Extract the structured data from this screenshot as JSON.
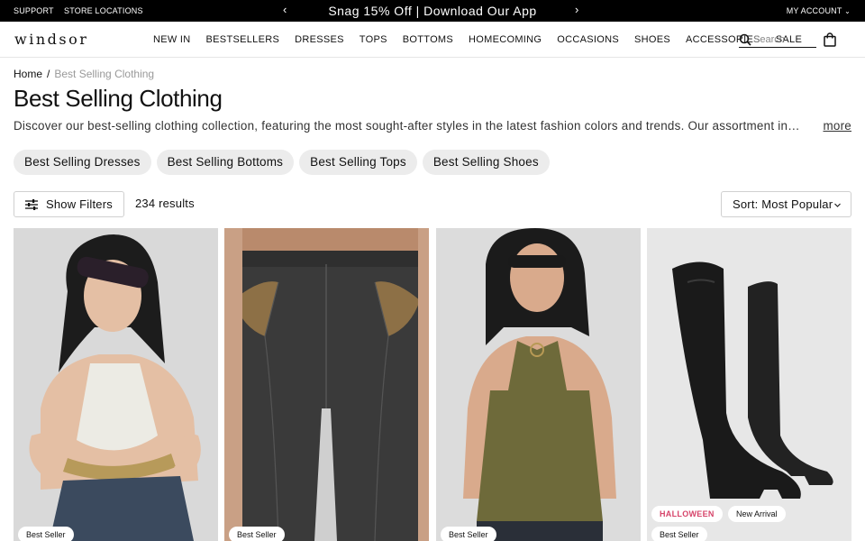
{
  "topbar": {
    "support": "SUPPORT",
    "store_locations": "STORE LOCATIONS",
    "promo": "Snag 15% Off | Download Our App",
    "account": "MY ACCOUNT"
  },
  "header": {
    "logo": "WINDSOR",
    "nav": [
      "NEW IN",
      "BESTSELLERS",
      "DRESSES",
      "TOPS",
      "BOTTOMS",
      "HOMECOMING",
      "OCCASIONS",
      "SHOES",
      "ACCESSORIES",
      "SALE"
    ],
    "search_placeholder": "Search"
  },
  "breadcrumb": {
    "home": "Home",
    "separator": "/",
    "current": "Best Selling Clothing"
  },
  "page": {
    "title": "Best Selling Clothing",
    "description": "Discover our best-selling clothing collection, featuring the most sought-after styles in the latest fashion colors and trends. Our assortment in…",
    "more": "more"
  },
  "categories": [
    "Best Selling Dresses",
    "Best Selling Bottoms",
    "Best Selling Tops",
    "Best Selling Shoes"
  ],
  "toolbar": {
    "filters_label": "Show Filters",
    "results": "234 results",
    "sort_label": "Sort: Most Popular"
  },
  "products": [
    {
      "badges": [
        "Best Seller"
      ]
    },
    {
      "badges": [
        "Best Seller"
      ]
    },
    {
      "badges": [
        "Best Seller"
      ]
    },
    {
      "badges": [
        "Best Seller"
      ],
      "tags": [
        "HALLOWEEN",
        "New Arrival"
      ]
    }
  ],
  "colors": {
    "topbar_bg": "#000000",
    "pill_bg": "#ececec",
    "halloween": "#d6446a"
  }
}
